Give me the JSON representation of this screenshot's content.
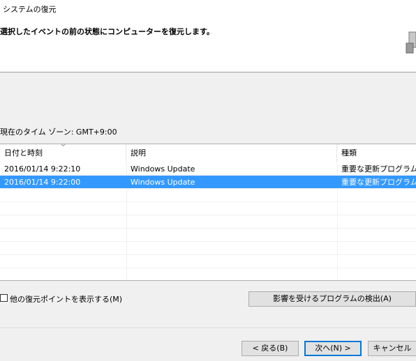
{
  "window": {
    "title": "システムの復元"
  },
  "header": {
    "instruction": "選択したイベントの前の状態にコンピューターを復元します。"
  },
  "timezone": {
    "label": "現在のタイム ゾーン: GMT+9:00"
  },
  "table": {
    "columns": [
      "日付と時刻",
      "説明",
      "種類"
    ],
    "rows": [
      {
        "date": "2016/01/14 9:22:10",
        "description": "Windows Update",
        "type": "重要な更新プログラム",
        "selected": false
      },
      {
        "date": "2016/01/14 9:22:00",
        "description": "Windows Update",
        "type": "重要な更新プログラム",
        "selected": true
      }
    ]
  },
  "options": {
    "show_more_label": "他の復元ポイントを表示する(M)"
  },
  "buttons": {
    "scan": "影響を受けるプログラムの検出(A)",
    "back": "< 戻る(B)",
    "next": "次へ(N) >",
    "cancel": "キャンセル"
  },
  "colors": {
    "selection": "#3399ff",
    "default_button_border": "#0078d7"
  }
}
